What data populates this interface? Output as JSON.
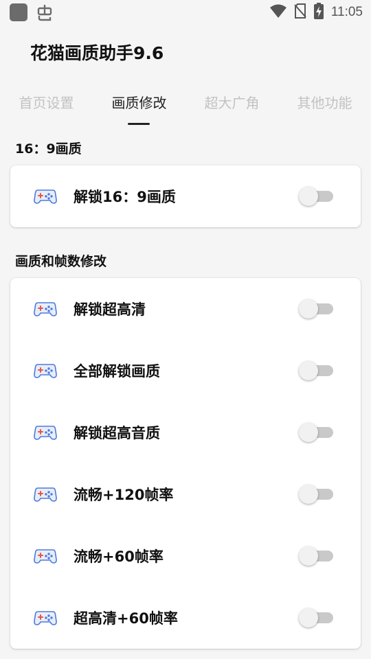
{
  "status_bar": {
    "time": "11:05",
    "icons": [
      "app-square-icon",
      "bug-icon",
      "wifi-icon",
      "no-sim-icon",
      "battery-charging-icon"
    ]
  },
  "app": {
    "title": "花猫画质助手9.6"
  },
  "tabs": [
    {
      "label": "首页设置",
      "active": false
    },
    {
      "label": "画质修改",
      "active": true
    },
    {
      "label": "超大广角",
      "active": false
    },
    {
      "label": "其他功能",
      "active": false
    }
  ],
  "sections": [
    {
      "title": "16：9画质",
      "items": [
        {
          "label": "解锁16：9画质",
          "icon": "gamepad-icon",
          "enabled": false
        }
      ]
    },
    {
      "title": "画质和帧数修改",
      "items": [
        {
          "label": "解锁超高清",
          "icon": "gamepad-icon",
          "enabled": false
        },
        {
          "label": "全部解锁画质",
          "icon": "gamepad-icon",
          "enabled": false
        },
        {
          "label": "解锁超高音质",
          "icon": "gamepad-icon",
          "enabled": false
        },
        {
          "label": "流畅+120帧率",
          "icon": "gamepad-icon",
          "enabled": false
        },
        {
          "label": "流畅+60帧率",
          "icon": "gamepad-icon",
          "enabled": false
        },
        {
          "label": "超高清+60帧率",
          "icon": "gamepad-icon",
          "enabled": false
        }
      ]
    }
  ],
  "colors": {
    "background": "#f5f5f5",
    "card": "#ffffff",
    "tab_active": "#222222",
    "tab_inactive": "#c2c2c2",
    "switch_track_off": "#c9c9c9",
    "icon_blue": "#4a7be0",
    "icon_red": "#e0584a"
  }
}
